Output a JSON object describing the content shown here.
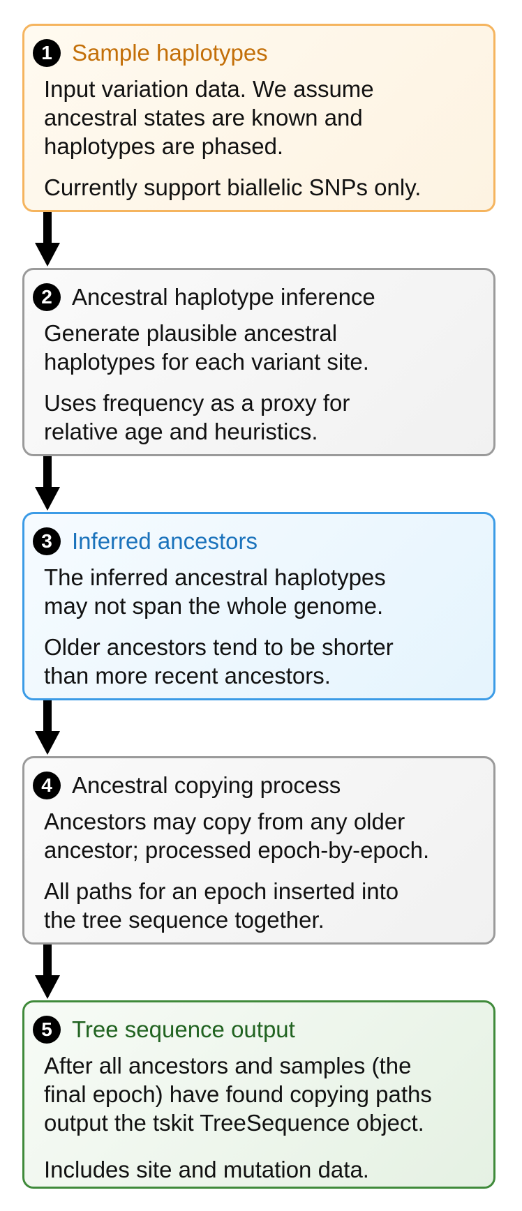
{
  "colors": {
    "step1_accent": "#c36f08",
    "step1_border": "#f5b45e",
    "step2_border": "#9a9a9a",
    "step3_accent": "#1a72bb",
    "step3_border": "#3b9be6",
    "step4_border": "#9a9a9a",
    "step5_accent": "#216321",
    "step5_border": "#3f8a3a",
    "arrow": "#000000"
  },
  "steps": [
    {
      "number": "1",
      "title": "Sample haplotypes",
      "paragraphs": [
        "Input variation data. We assume\nancestral states are known and\nhaplotypes are phased.",
        "Currently support biallelic SNPs only."
      ]
    },
    {
      "number": "2",
      "title": "Ancestral haplotype inference",
      "paragraphs": [
        "Generate plausible ancestral\nhaplotypes for each variant site.",
        "Uses frequency as a proxy for\nrelative age and heuristics."
      ]
    },
    {
      "number": "3",
      "title": "Inferred ancestors",
      "paragraphs": [
        "The inferred ancestral haplotypes\nmay not span the whole genome.",
        "Older ancestors tend to be shorter\nthan more recent ancestors."
      ]
    },
    {
      "number": "4",
      "title": "Ancestral copying process",
      "paragraphs": [
        "Ancestors may copy from any older\nancestor; processed epoch-by-epoch.",
        "All paths for an epoch inserted into\nthe tree sequence together."
      ]
    },
    {
      "number": "5",
      "title": "Tree sequence output",
      "paragraphs": [
        "After all ancestors and samples (the\nfinal epoch) have found copying paths\noutput the tskit TreeSequence object.",
        "Includes site and mutation data."
      ]
    }
  ]
}
